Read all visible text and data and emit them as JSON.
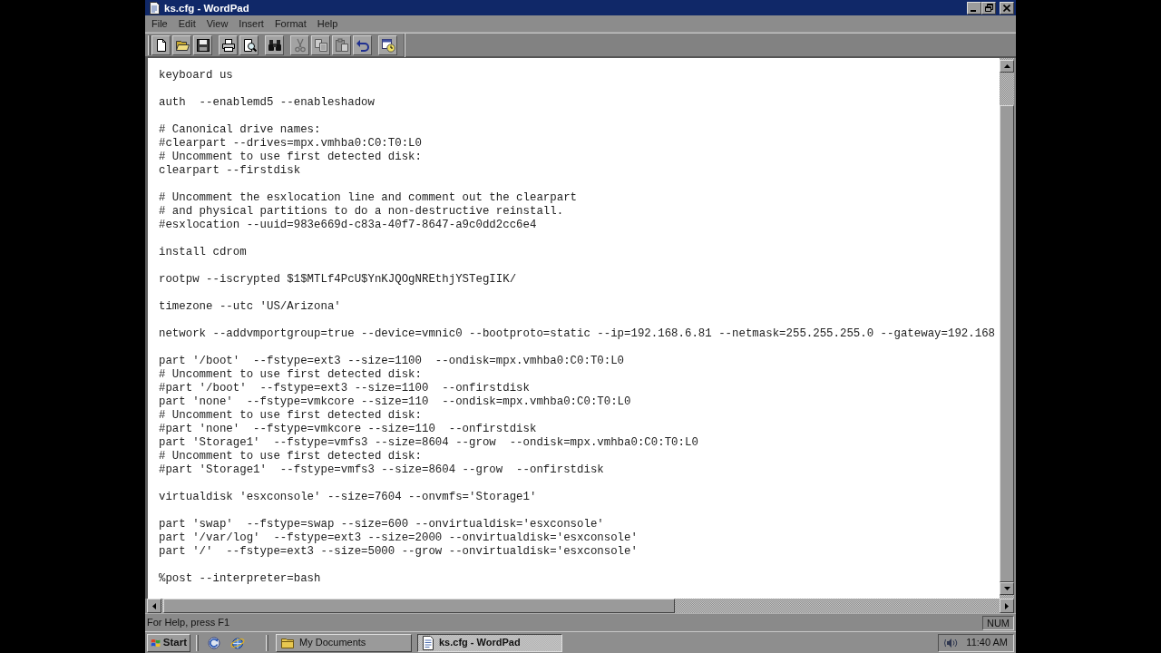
{
  "window": {
    "title": "ks.cfg - WordPad"
  },
  "menu": [
    "File",
    "Edit",
    "View",
    "Insert",
    "Format",
    "Help"
  ],
  "toolbar": [
    [
      {
        "kind": "new",
        "disabled": false
      },
      {
        "kind": "open",
        "disabled": false
      },
      {
        "kind": "save",
        "disabled": false
      }
    ],
    [
      {
        "kind": "print",
        "disabled": false
      },
      {
        "kind": "preview",
        "disabled": false
      }
    ],
    [
      {
        "kind": "find",
        "disabled": false
      }
    ],
    [
      {
        "kind": "cut",
        "disabled": true
      },
      {
        "kind": "copy",
        "disabled": true
      },
      {
        "kind": "paste",
        "disabled": true
      },
      {
        "kind": "undo",
        "disabled": false
      }
    ],
    [
      {
        "kind": "datetime",
        "disabled": false
      }
    ]
  ],
  "document": {
    "blocks": [
      [
        "keyboard us"
      ],
      [
        "auth  --enablemd5 --enableshadow"
      ],
      [
        "# Canonical drive names:",
        "#clearpart --drives=mpx.vmhba0:C0:T0:L0",
        "# Uncomment to use first detected disk:",
        "clearpart --firstdisk"
      ],
      [
        "# Uncomment the esxlocation line and comment out the clearpart",
        "# and physical partitions to do a non-destructive reinstall.",
        "#esxlocation --uuid=983e669d-c83a-40f7-8647-a9c0dd2cc6e4"
      ],
      [
        "install cdrom"
      ],
      [
        "rootpw --iscrypted $1$MTLf4PcU$YnKJQOgNREthjYSTegIIK/"
      ],
      [
        "timezone --utc 'US/Arizona'"
      ],
      [
        "network --addvmportgroup=true --device=vmnic0 --bootproto=static --ip=192.168.6.81 --netmask=255.255.255.0 --gateway=192.168"
      ],
      [
        "part '/boot'  --fstype=ext3 --size=1100  --ondisk=mpx.vmhba0:C0:T0:L0",
        "# Uncomment to use first detected disk:",
        "#part '/boot'  --fstype=ext3 --size=1100  --onfirstdisk",
        "part 'none'  --fstype=vmkcore --size=110  --ondisk=mpx.vmhba0:C0:T0:L0",
        "# Uncomment to use first detected disk:",
        "#part 'none'  --fstype=vmkcore --size=110  --onfirstdisk",
        "part 'Storage1'  --fstype=vmfs3 --size=8604 --grow  --ondisk=mpx.vmhba0:C0:T0:L0",
        "# Uncomment to use first detected disk:",
        "#part 'Storage1'  --fstype=vmfs3 --size=8604 --grow  --onfirstdisk"
      ],
      [
        "virtualdisk 'esxconsole' --size=7604 --onvmfs='Storage1'"
      ],
      [
        "part 'swap'  --fstype=swap --size=600 --onvirtualdisk='esxconsole'",
        "part '/var/log'  --fstype=ext3 --size=2000 --onvirtualdisk='esxconsole'",
        "part '/'  --fstype=ext3 --size=5000 --grow --onvirtualdisk='esxconsole'"
      ],
      [
        "%post --interpreter=bash"
      ]
    ]
  },
  "status_bar": {
    "text": "For Help, press F1",
    "indicator": "NUM"
  },
  "taskbar": {
    "start": "Start",
    "buttons": [
      {
        "kind": "folder",
        "label": "My Documents",
        "selected": false
      },
      {
        "kind": "document",
        "label": "ks.cfg - WordPad",
        "selected": true
      }
    ],
    "clock": "11:40 AM"
  }
}
